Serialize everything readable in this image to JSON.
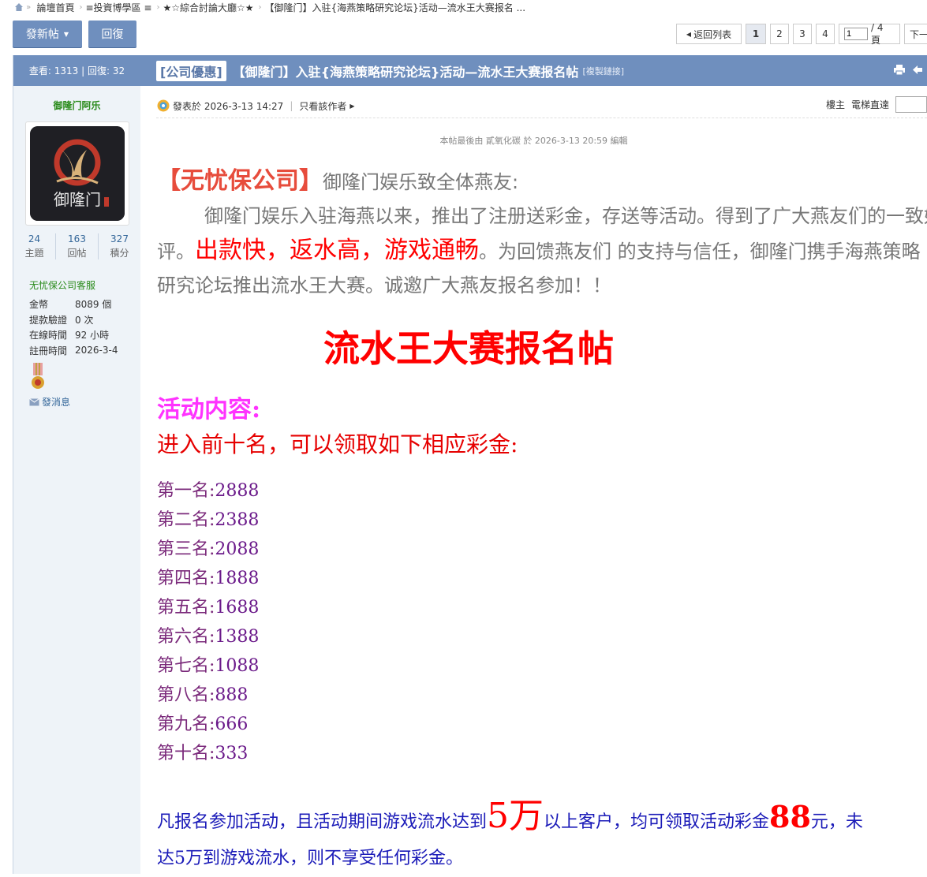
{
  "breadcrumb": {
    "items": [
      "論壇首頁",
      "≡投資博學區 ≡",
      "★☆綜合討論大廳☆★",
      "【御隆门】入驻{海燕策略研究论坛}活动—流水王大赛报名 ..."
    ]
  },
  "toolbar": {
    "new_post": "發新帖",
    "reply": "回復"
  },
  "pager": {
    "back": "返回列表",
    "pages": [
      "1",
      "2",
      "3",
      "4"
    ],
    "current_page": "1",
    "total": "/ 4 頁",
    "next": "下一"
  },
  "sidebar": {
    "views_replies": "查看: 1313 | 回復: 32",
    "username": "御隆门阿乐",
    "avatar_text": "御隆门",
    "stats": [
      {
        "value": "24",
        "label": "主題"
      },
      {
        "value": "163",
        "label": "回帖"
      },
      {
        "value": "327",
        "label": "積分"
      }
    ],
    "group": "无忧保公司客服",
    "info": [
      {
        "key": "金幣",
        "value": "8089 個"
      },
      {
        "key": "提款驗證",
        "value": "0 次"
      },
      {
        "key": "在線時間",
        "value": "92 小時"
      },
      {
        "key": "註冊時間",
        "value": "2026-3-4"
      }
    ],
    "message": "發消息"
  },
  "thread": {
    "tag": "[公司優惠]",
    "title": "【御隆门】入驻{海燕策略研究论坛}活动—流水王大赛报名帖",
    "copy_link": "[複製鏈接]"
  },
  "post": {
    "meta": "發表於 2026-3-13 14:27",
    "only_author": "只看該作者",
    "floor_label": "樓主",
    "jump_label": "電梯直達",
    "edited": "本帖最後由 貳氧化碳 於 2026-3-13 20:59 編輯"
  },
  "content": {
    "brand": "【无忧保公司】",
    "greeting": "御隆门娱乐致全体燕友:",
    "para_a": "御隆门娱乐入驻海燕以来，推出了注册送彩金，存送等活动。得到了广大燕友们的一致好",
    "para_b1": "评。",
    "para_b_red": "出款快，返水高，游戏通畅",
    "para_b2": "。为回馈燕友们 的支持与信任，御隆门携手海燕策略",
    "para_c": "研究论坛推出流水王大赛。诚邀广大燕友报名参加！！",
    "big_title": "流水王大赛报名帖",
    "activity_heading": "活动内容:",
    "activity_sub": "进入前十名，可以领取如下相应彩金:",
    "ranks": [
      {
        "label": "第一名:",
        "value": "2888"
      },
      {
        "label": "第二名:",
        "value": "2388"
      },
      {
        "label": "第三名:",
        "value": "2088"
      },
      {
        "label": "第四名:",
        "value": "1888"
      },
      {
        "label": "第五名:",
        "value": "1688"
      },
      {
        "label": "第六名:",
        "value": "1388"
      },
      {
        "label": "第七名:",
        "value": "1088"
      },
      {
        "label": "第八名:",
        "value": "888"
      },
      {
        "label": "第九名:",
        "value": "666"
      },
      {
        "label": "第十名:",
        "value": "333"
      }
    ],
    "note_a": "凡报名参加活动，且活动期间游戏流水达到",
    "note_big1": "5万",
    "note_b": "以上客户，均可领取活动彩金",
    "note_big2": "88",
    "note_c": "元，未",
    "note_d": "达5万到游戏流水，则不享受任何彩金。"
  }
}
